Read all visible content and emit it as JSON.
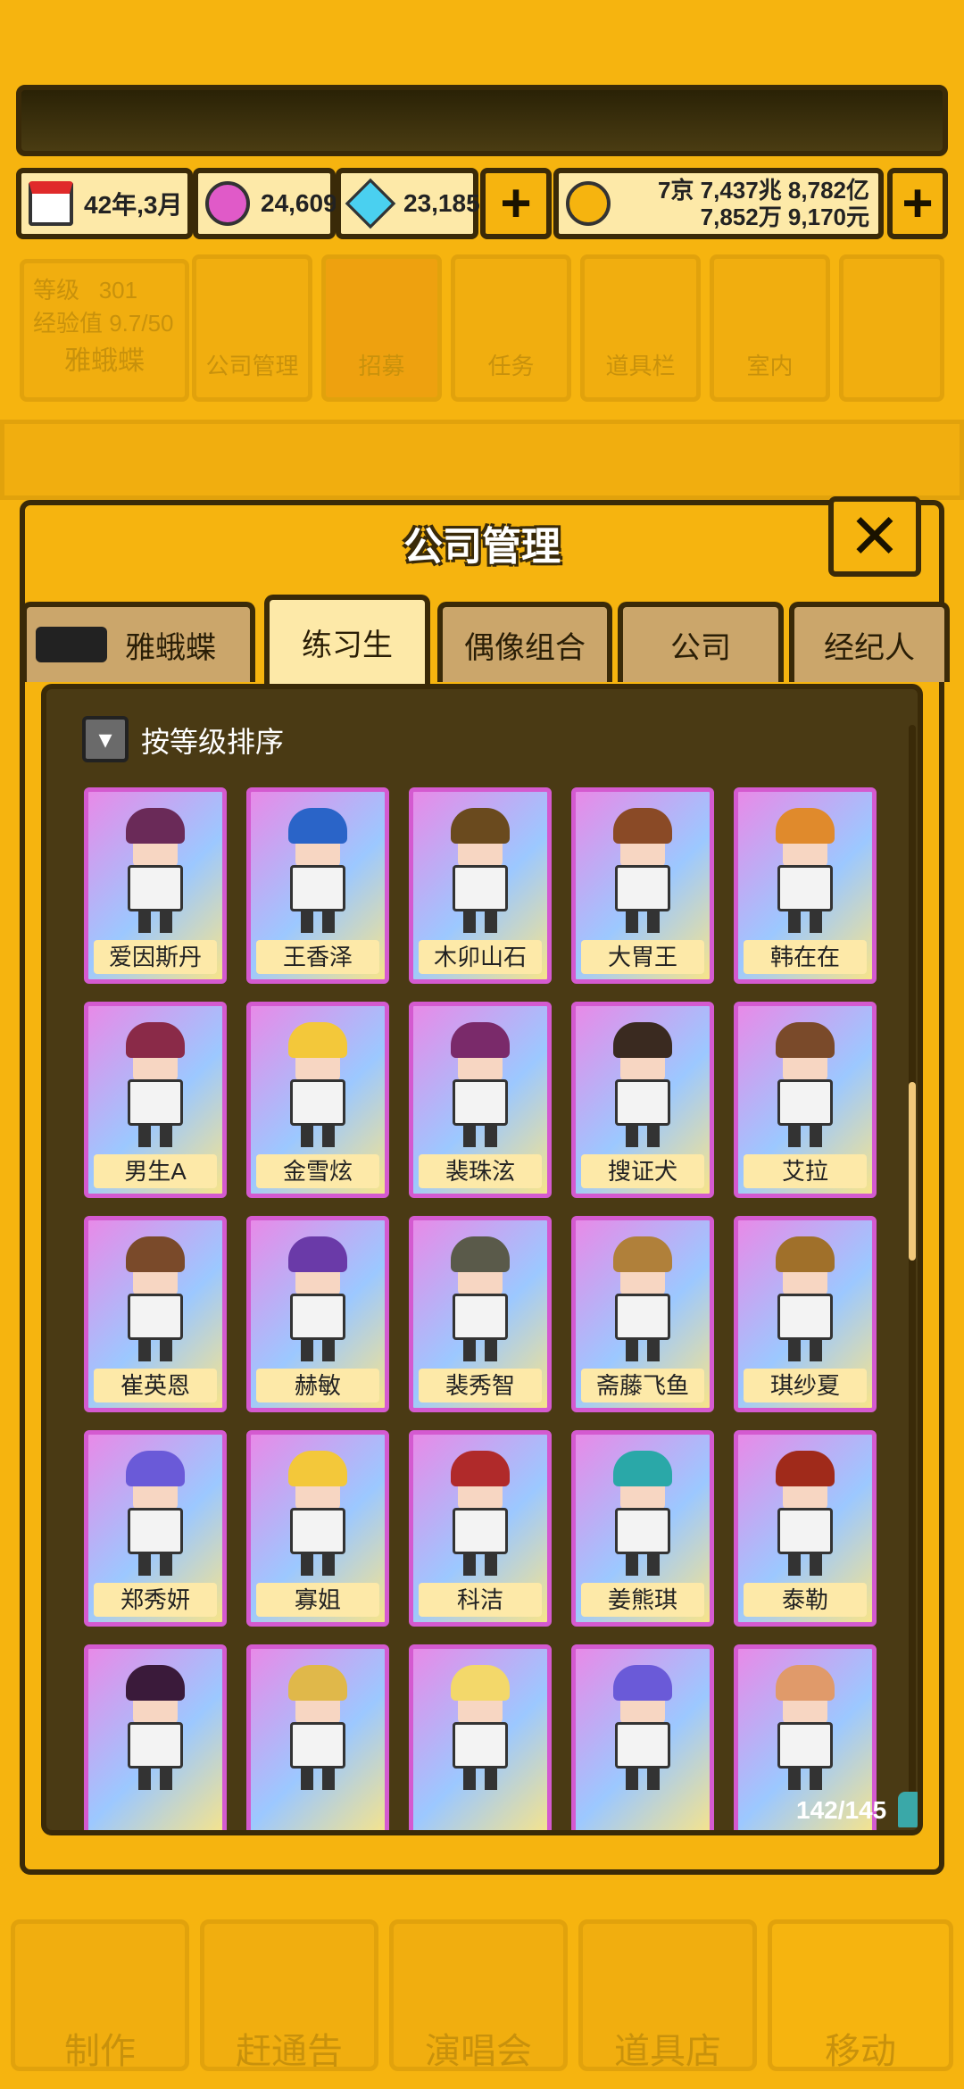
{
  "status": {
    "date": "42年,3月",
    "pink_gem": "24,609",
    "blue_gem": "23,185",
    "money_line1": "7京 7,437兆 8,782亿",
    "money_line2": "7,852万 9,170元"
  },
  "background": {
    "level_label": "等级",
    "level_value": "301",
    "exp_label": "经验值 9.7/50",
    "company_name": "雅蛾蝶",
    "tiles": [
      "公司管理",
      "招募",
      "任务",
      "道具栏",
      "室内"
    ],
    "bottom_nav": [
      "制作",
      "赶通告",
      "演唱会",
      "道具店",
      "移动"
    ]
  },
  "modal": {
    "title": "公司管理",
    "tabs": [
      "雅蛾蝶",
      "练习生",
      "偶像组合",
      "公司",
      "经纪人"
    ],
    "active_tab": 1,
    "sort_label": "按等级排序",
    "count": "142/145"
  },
  "trainees": [
    {
      "name": "爱因斯丹",
      "hair": "#6a2a58"
    },
    {
      "name": "王香泽",
      "hair": "#2a64c8"
    },
    {
      "name": "木卯山石",
      "hair": "#6a4a1e"
    },
    {
      "name": "大胃王",
      "hair": "#8a4a26"
    },
    {
      "name": "韩在在",
      "hair": "#e08a2c"
    },
    {
      "name": "男生A",
      "hair": "#8a2a48"
    },
    {
      "name": "金雪炫",
      "hair": "#f3c83a"
    },
    {
      "name": "裴珠泫",
      "hair": "#7a2a6a"
    },
    {
      "name": "搜证犬",
      "hair": "#3a2a20"
    },
    {
      "name": "艾拉",
      "hair": "#7a4a2a"
    },
    {
      "name": "崔英恩",
      "hair": "#7a4a2a"
    },
    {
      "name": "赫敏",
      "hair": "#6a3aa8"
    },
    {
      "name": "裴秀智",
      "hair": "#5a5a4a"
    },
    {
      "name": "斋藤飞鱼",
      "hair": "#b0803a"
    },
    {
      "name": "琪纱夏",
      "hair": "#a0702a"
    },
    {
      "name": "郑秀妍",
      "hair": "#6a5ad8"
    },
    {
      "name": "寡姐",
      "hair": "#f3c83a"
    },
    {
      "name": "科洁",
      "hair": "#b02a2a"
    },
    {
      "name": "姜熊琪",
      "hair": "#2aa8a8"
    },
    {
      "name": "泰勒",
      "hair": "#a02a1a"
    },
    {
      "name": "",
      "hair": "#3a1a3a"
    },
    {
      "name": "",
      "hair": "#e0b84a"
    },
    {
      "name": "",
      "hair": "#f3d86a"
    },
    {
      "name": "",
      "hair": "#6a5ad8"
    },
    {
      "name": "",
      "hair": "#e09a6a"
    }
  ]
}
